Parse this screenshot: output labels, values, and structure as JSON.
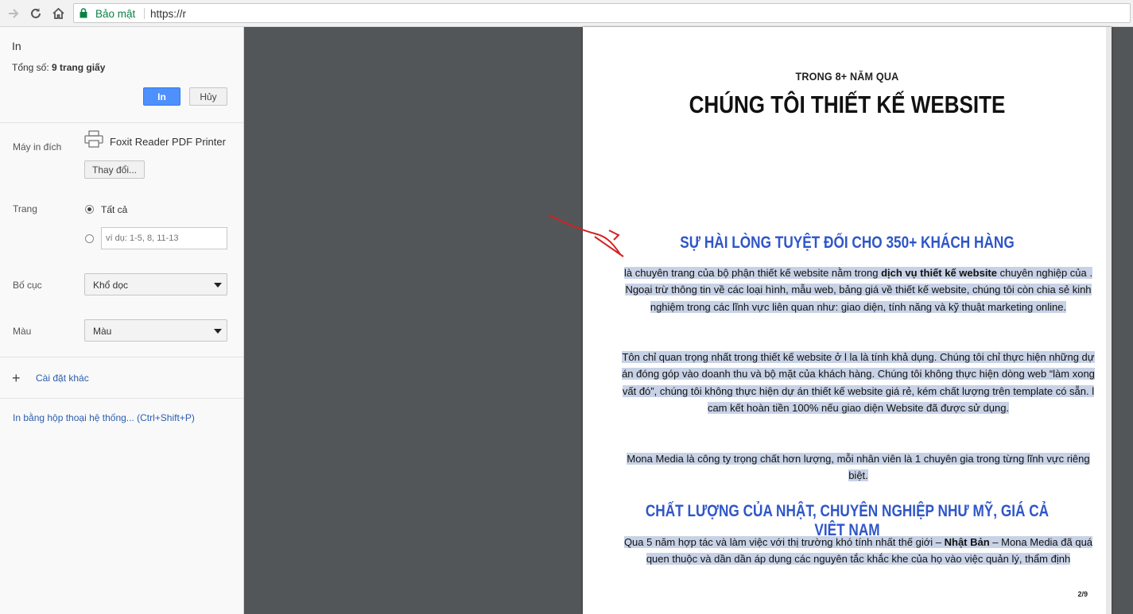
{
  "toolbar": {
    "security_label": "Bảo mật",
    "url": "https://r"
  },
  "print_panel": {
    "title": "In",
    "total_label": "Tổng số: ",
    "total_value": "9 trang giấy",
    "print_button": "In",
    "cancel_button": "Hủy",
    "destination_label": "Máy in đích",
    "printer_name": "Foxit Reader PDF Printer",
    "change_button": "Thay đổi...",
    "pages_label": "Trang",
    "pages_all": "Tất cả",
    "pages_placeholder": "ví dụ: 1-5, 8, 11-13",
    "layout_label": "Bố cục",
    "layout_value": "Khổ dọc",
    "color_label": "Màu",
    "color_value": "Màu",
    "more_settings": "Cài đặt khác",
    "system_dialog": "In bằng hộp thoại hệ thống... (Ctrl+Shift+P)"
  },
  "preview": {
    "subtitle": "TRONG 8+ NĂM QUA",
    "title": "CHÚNG TÔI THIẾT KẾ WEBSITE",
    "heading1": "SỰ HÀI LÒNG TUYỆT ĐỐI CHO 350+ KHÁCH HÀNG",
    "para1": {
      "lead": "là chuyên trang của bộ phận thiết kế website nằm trong ",
      "bold1": "dịch vụ thiết kế website",
      "rest": " chuyên nghiệp của . Ngoại trừ thông tin về các loại hình, mẫu web, bảng giá về thiết kế website, chúng tôi còn chia sẻ kinh nghiệm trong các lĩnh vực liên quan như: giao diện, tính năng và kỹ thuật marketing online."
    },
    "para2": "Tôn chỉ quan trọng nhất trong thiết kế website ở l la là tính khả dụng. Chúng tôi chỉ thực hiện những dự án đóng góp vào doanh thu và bộ mặt của khách hàng. Chúng tôi không thực hiện dòng web “làm xong vất đó”, chúng tôi không thực hiện dự án thiết kế website giá rẻ, kém chất lượng trên template có sẵn. l cam kết hoàn tiền 100% nếu giao diện Website đã được sử dụng.",
    "para3": "Mona Media là công ty trọng chất hơn lượng, mỗi nhân viên là 1 chuyên gia trong từng lĩnh vực riêng biệt.",
    "heading2": "CHẤT LƯỢNG CỦA NHẬT, CHUYÊN NGHIỆP NHƯ MỸ, GIÁ CẢ VIỆT NAM",
    "para4": {
      "lead": "Qua 5 năm hợp tác và làm việc với thị trường khó tính nhất thế giới – ",
      "bold": "Nhật Bản",
      "rest": " – Mona Media đã quá quen thuộc và dần dần áp dụng các nguyên tắc khắc khe của họ vào việc quản lý, thẩm định"
    },
    "page_number": "2/9"
  }
}
